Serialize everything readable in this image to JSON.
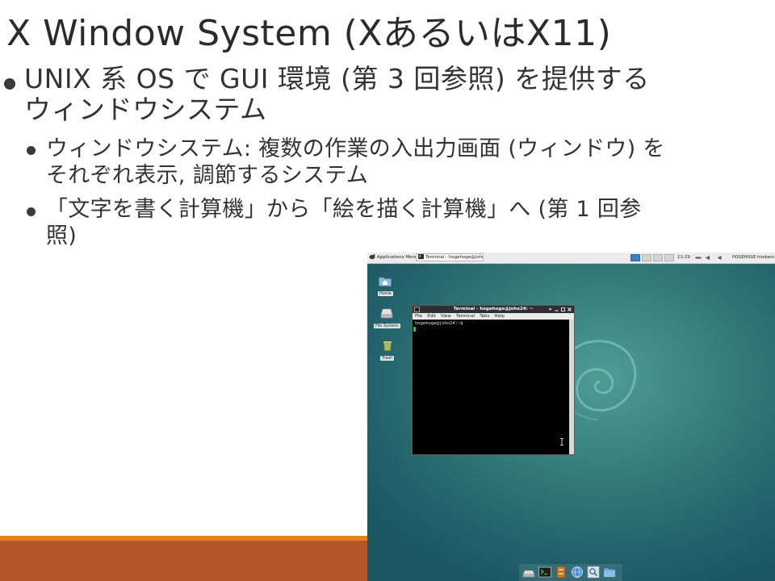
{
  "slide": {
    "title": "X Window System (XあるいはX11)",
    "bullets": [
      {
        "lines": [
          "UNIX 系 OS で GUI 環境 (第 3 回参照) を提供する",
          "ウィンドウシステム"
        ],
        "sub": [
          {
            "lines": [
              "ウィンドウシステム: 複数の作業の入出力画面 (ウィンドウ) を",
              "それぞれ表示, 調節するシステム"
            ]
          },
          {
            "lines": [
              "「文字を書く計算機」から「絵を描く計算機」へ (第 1 回参",
              "照)"
            ]
          }
        ]
      }
    ]
  },
  "desktop": {
    "panel": {
      "apps_menu": "Applications Menu",
      "task": "Terminal - hogehoge@joho...",
      "clock": "11:29",
      "user": "HOGEHOGE hirobaro"
    },
    "icons": [
      {
        "label": "Home",
        "icon": "home-folder-icon"
      },
      {
        "label": "File System",
        "icon": "drive-icon"
      },
      {
        "label": "Trash",
        "icon": "trash-icon"
      }
    ],
    "terminal": {
      "title": "Terminal - hogehoge@joho24: ~",
      "menu": [
        "File",
        "Edit",
        "View",
        "Terminal",
        "Tabs",
        "Help"
      ],
      "prompt": "hogehoge@joho24:~$"
    },
    "dock": [
      {
        "icon": "drive-icon"
      },
      {
        "icon": "terminal-icon"
      },
      {
        "icon": "file-manager-icon"
      },
      {
        "icon": "web-browser-icon"
      },
      {
        "icon": "search-icon"
      },
      {
        "icon": "folder-icon"
      }
    ]
  },
  "colors": {
    "accent": "#e8821e",
    "band": "#b5562a",
    "desktop": "#337a78",
    "terminal_cursor": "#22c32e",
    "workspace_active": "#3b7fc4"
  }
}
